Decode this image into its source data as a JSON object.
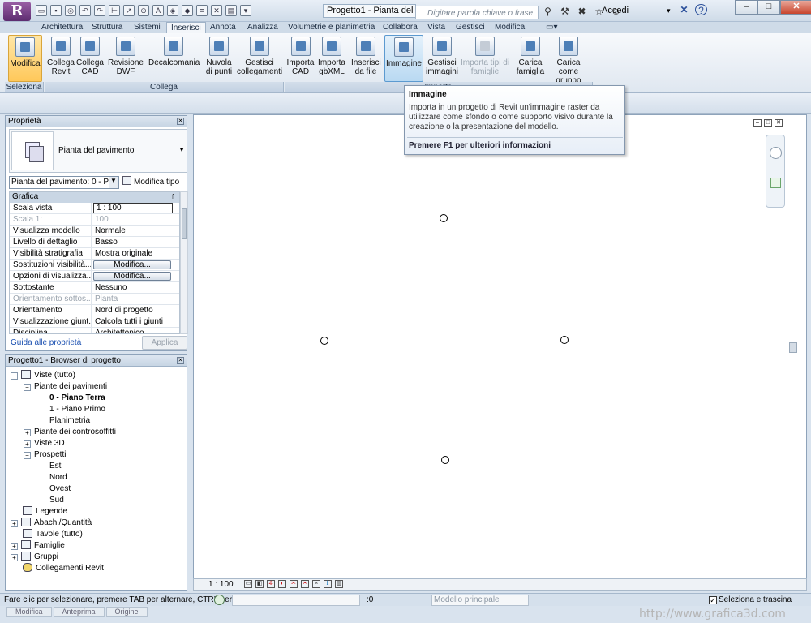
{
  "app": {
    "logo_letter": "R"
  },
  "title_bar": {
    "document_title": "Progetto1 - Pianta del pa...",
    "search_placeholder": "Digitare parola chiave o frase",
    "login_label": "Accedi",
    "help_label": "?"
  },
  "tabs": [
    "Architettura",
    "Struttura",
    "Sistemi",
    "Inserisci",
    "Annota",
    "Analizza",
    "Volumetrie e planimetria",
    "Collabora",
    "Vista",
    "Gestisci",
    "Modifica"
  ],
  "active_tab": "Inserisci",
  "ribbon": {
    "buttons": {
      "modifica": "Modifica",
      "collega_revit": "Collega Revit",
      "collega_cad": "Collega CAD",
      "revisione_dwf": "Revisione DWF",
      "decalcomania": "Decalcomania",
      "nuvola": "Nuvola di punti",
      "gestisci_collegamenti": "Gestisci collegamenti",
      "importa_cad": "Importa CAD",
      "importa_gbxml": "Importa gbXML",
      "inserisci_file": "Inserisci da file",
      "immagine": "Immagine",
      "gestisci_immagini": "Gestisci immagini",
      "importa_tipi": "Importa tipi di famiglie",
      "carica_famiglia": "Carica famiglia",
      "carica_gruppo": "Carica come gruppo"
    },
    "panels": {
      "seleziona": "Seleziona",
      "collega": "Collega",
      "importa": "Importa"
    }
  },
  "properties": {
    "title": "Proprietà",
    "type_name": "Pianta del pavimento",
    "instance_selector": "Pianta del pavimento: 0 - Pia",
    "edit_type": "Modifica tipo",
    "category": "Grafica",
    "rows": [
      {
        "name": "Scala vista",
        "value": "1 : 100",
        "kind": "input"
      },
      {
        "name": "Scala 1:",
        "value": "100",
        "kind": "gray"
      },
      {
        "name": "Visualizza modello",
        "value": "Normale",
        "kind": "text"
      },
      {
        "name": "Livello di dettaglio",
        "value": "Basso",
        "kind": "text"
      },
      {
        "name": "Visibilità stratigrafia",
        "value": "Mostra originale",
        "kind": "text"
      },
      {
        "name": "Sostituzioni visibilità...",
        "value": "Modifica...",
        "kind": "button"
      },
      {
        "name": "Opzioni di visualizza...",
        "value": "Modifica...",
        "kind": "button"
      },
      {
        "name": "Sottostante",
        "value": "Nessuno",
        "kind": "text"
      },
      {
        "name": "Orientamento sottos...",
        "value": "Pianta",
        "kind": "gray"
      },
      {
        "name": "Orientamento",
        "value": "Nord di progetto",
        "kind": "text"
      },
      {
        "name": "Visualizzazione giunt...",
        "value": "Calcola tutti i giunti",
        "kind": "text"
      },
      {
        "name": "Disciplina",
        "value": "Architettonico",
        "kind": "text"
      }
    ],
    "help_link": "Guida alle proprietà",
    "apply_label": "Applica"
  },
  "browser": {
    "title": "Progetto1 - Browser di progetto",
    "nodes": {
      "viste": "Viste (tutto)",
      "piante_pav": "Piante dei pavimenti",
      "piano_terra": "0 - Piano Terra",
      "piano_primo": "1 - Piano Primo",
      "planimetria": "Planimetria",
      "piante_contro": "Piante dei controsoffitti",
      "viste_3d": "Viste 3D",
      "prospetti": "Prospetti",
      "est": "Est",
      "nord": "Nord",
      "ovest": "Ovest",
      "sud": "Sud",
      "legende": "Legende",
      "abachi": "Abachi/Quantità",
      "tavole": "Tavole (tutto)",
      "famiglie": "Famiglie",
      "gruppi": "Gruppi",
      "collegamenti": "Collegamenti Revit"
    }
  },
  "tooltip": {
    "title": "Immagine",
    "body": "Importa in un progetto di Revit un'immagine raster da utilizzare come sfondo o come supporto visivo durante la creazione o la presentazione del modello.",
    "help": "Premere F1 per ulteriori informazioni"
  },
  "view_bar": {
    "scale": "1 : 100"
  },
  "status_bar": {
    "text": "Fare clic per selezionare, premere TAB per alternare, CTRL per",
    "count": ":0",
    "model": "Modello principale",
    "drag_label": "Selezionа e trascina",
    "bottom_tabs": [
      "Modifica",
      "Anteprima",
      "Origine"
    ]
  },
  "watermark": "http://www.grafica3d.com"
}
